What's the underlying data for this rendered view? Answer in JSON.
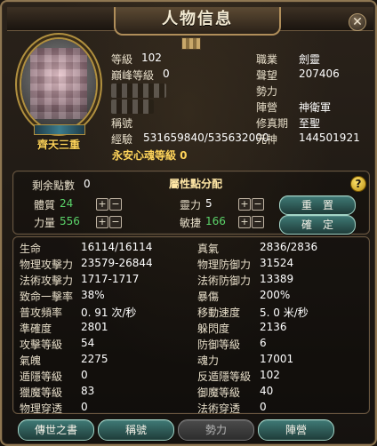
{
  "window": {
    "title": "人物信息",
    "close_glyph": "✕"
  },
  "profile": {
    "portrait_caption": "齊天三重",
    "stats_left": [
      {
        "label": "等級",
        "value": "102"
      },
      {
        "label": "巔峰等級",
        "value": "0"
      },
      {
        "label": "稱號",
        "value": ""
      },
      {
        "label": "經驗",
        "value": "531659840/535632000"
      }
    ],
    "soul_grade": "永安心魂等級 0",
    "stats_right": [
      {
        "label": "職業",
        "value": "劍靈"
      },
      {
        "label": "聲望",
        "value": "207406"
      },
      {
        "label": "勢力",
        "value": ""
      },
      {
        "label": "陣營",
        "value": "神衛軍"
      },
      {
        "label": "修真期",
        "value": "至聖"
      },
      {
        "label": "元神",
        "value": "144501921"
      }
    ]
  },
  "attributes": {
    "remaining_points_label": "剩余點數",
    "remaining_points_value": "0",
    "title": "屬性點分配",
    "help_glyph": "?",
    "items": [
      {
        "label": "體質",
        "value": "24",
        "value_color": "#5bd46a"
      },
      {
        "label": "力量",
        "value": "556",
        "value_color": "#5bd46a"
      },
      {
        "label": "靈力",
        "value": "5",
        "value_color": "#ffffff"
      },
      {
        "label": "敏捷",
        "value": "166",
        "value_color": "#5bd46a"
      }
    ],
    "plus_glyph": "+",
    "minus_glyph": "−",
    "buttons": {
      "reset": "重　置",
      "confirm": "確　定"
    }
  },
  "stats": {
    "rows": [
      {
        "left_label": "生命",
        "left_value": "16114/16114",
        "right_label": "真氣",
        "right_value": "2836/2836"
      },
      {
        "left_label": "物理攻擊力",
        "left_value": "23579-26844",
        "right_label": "物理防御力",
        "right_value": "31524"
      },
      {
        "left_label": "法術攻擊力",
        "left_value": "1717-1717",
        "right_label": "法術防御力",
        "right_value": "13389"
      },
      {
        "left_label": "致命一擊率",
        "left_value": "38%",
        "right_label": "暴傷",
        "right_value": "200%"
      },
      {
        "left_label": "普攻頻率",
        "left_value": "0. 91 次/秒",
        "right_label": "移動速度",
        "right_value": "5. 0 米/秒"
      },
      {
        "left_label": "準確度",
        "left_value": "2801",
        "right_label": "躲閃度",
        "right_value": "2136"
      },
      {
        "left_label": "攻擊等級",
        "left_value": "54",
        "right_label": "防御等級",
        "right_value": "6"
      },
      {
        "left_label": "氣魄",
        "left_value": "2275",
        "right_label": "魂力",
        "right_value": "17001"
      },
      {
        "left_label": "遁隱等級",
        "left_value": "0",
        "right_label": "反遁隱等級",
        "right_value": "102"
      },
      {
        "left_label": "獵魔等級",
        "left_value": "83",
        "right_label": "御魔等級",
        "right_value": "40"
      },
      {
        "left_label": "物理穿透",
        "left_value": "0",
        "right_label": "法術穿透",
        "right_value": "0"
      }
    ]
  },
  "bottom_tabs": [
    {
      "label": "傳世之書",
      "enabled": true
    },
    {
      "label": "稱號",
      "enabled": true
    },
    {
      "label": "勢力",
      "enabled": false
    },
    {
      "label": "陣營",
      "enabled": true
    }
  ],
  "colors": {
    "accent_yellow": "#ffd45a",
    "accent_green": "#5bd46a",
    "panel_border": "#6a5740",
    "button_teal": "#3f7a76"
  }
}
